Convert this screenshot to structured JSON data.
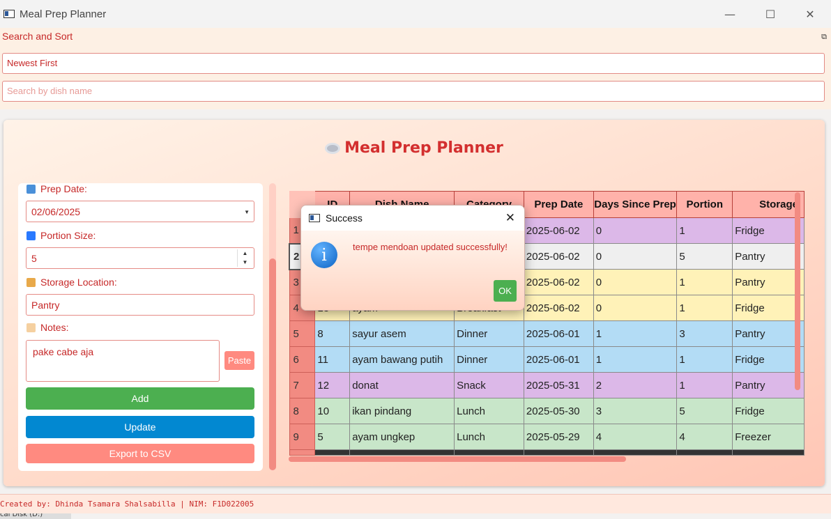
{
  "window": {
    "title": "Meal Prep Planner",
    "minimize": "—",
    "maximize": "☐",
    "close": "✕"
  },
  "dock": {
    "title": "Search and Sort",
    "float_icon": "⧉",
    "sort_value": "Newest First",
    "search_placeholder": "Search by dish name"
  },
  "header": {
    "title": "Meal Prep Planner"
  },
  "form": {
    "prep_date_label": "Prep Date:",
    "prep_date_value": "02/06/2025",
    "portion_label": "Portion Size:",
    "portion_value": "5",
    "storage_label": "Storage Location:",
    "storage_value": "Pantry",
    "notes_label": "Notes:",
    "notes_value": "pake cabe aja",
    "paste_label": "Paste",
    "add_label": "Add",
    "update_label": "Update",
    "export_label": "Export to CSV"
  },
  "table": {
    "columns": [
      "ID",
      "Dish Name",
      "Category",
      "Prep Date",
      "Days Since Prep",
      "Portion",
      "Storage"
    ],
    "rows": [
      {
        "n": "1",
        "id": "",
        "dish": "",
        "category": "",
        "date": "2025-06-02",
        "days": "0",
        "portion": "1",
        "storage": "Fridge",
        "color": "#dcb8e8"
      },
      {
        "n": "2",
        "id": "",
        "dish": "",
        "category": "",
        "date": "2025-06-02",
        "days": "0",
        "portion": "5",
        "storage": "Pantry",
        "color": "#efefef"
      },
      {
        "n": "3",
        "id": "",
        "dish": "",
        "category": "",
        "date": "2025-06-02",
        "days": "0",
        "portion": "1",
        "storage": "Pantry",
        "color": "#fff2b8"
      },
      {
        "n": "4",
        "id": "13",
        "dish": "ayam",
        "category": "Breakfast",
        "date": "2025-06-02",
        "days": "0",
        "portion": "1",
        "storage": "Fridge",
        "color": "#fff2b8"
      },
      {
        "n": "5",
        "id": "8",
        "dish": "sayur asem",
        "category": "Dinner",
        "date": "2025-06-01",
        "days": "1",
        "portion": "3",
        "storage": "Pantry",
        "color": "#b3dcf5"
      },
      {
        "n": "6",
        "id": "11",
        "dish": "ayam bawang putih",
        "category": "Dinner",
        "date": "2025-06-01",
        "days": "1",
        "portion": "1",
        "storage": "Fridge",
        "color": "#b3dcf5"
      },
      {
        "n": "7",
        "id": "12",
        "dish": "donat",
        "category": "Snack",
        "date": "2025-05-31",
        "days": "2",
        "portion": "1",
        "storage": "Pantry",
        "color": "#dcb8e8"
      },
      {
        "n": "8",
        "id": "10",
        "dish": "ikan pindang",
        "category": "Lunch",
        "date": "2025-05-30",
        "days": "3",
        "portion": "5",
        "storage": "Fridge",
        "color": "#c8e6c9"
      },
      {
        "n": "9",
        "id": "5",
        "dish": "ayam ungkep",
        "category": "Lunch",
        "date": "2025-05-29",
        "days": "4",
        "portion": "4",
        "storage": "Freezer",
        "color": "#c8e6c9"
      }
    ]
  },
  "dialog": {
    "title": "Success",
    "close": "✕",
    "message": "tempe mendoan updated successfully!",
    "ok_label": "OK",
    "info_glyph": "i"
  },
  "footer": {
    "text": "Created by: Dhinda Tsamara Shalsabilla | NIM: F1D022005"
  },
  "taskbar": {
    "text": "cal Disk (D:)"
  },
  "colors": {
    "accent": "#c62828",
    "add": "#4caf50",
    "update": "#0288d1",
    "export": "#ff8a80"
  }
}
